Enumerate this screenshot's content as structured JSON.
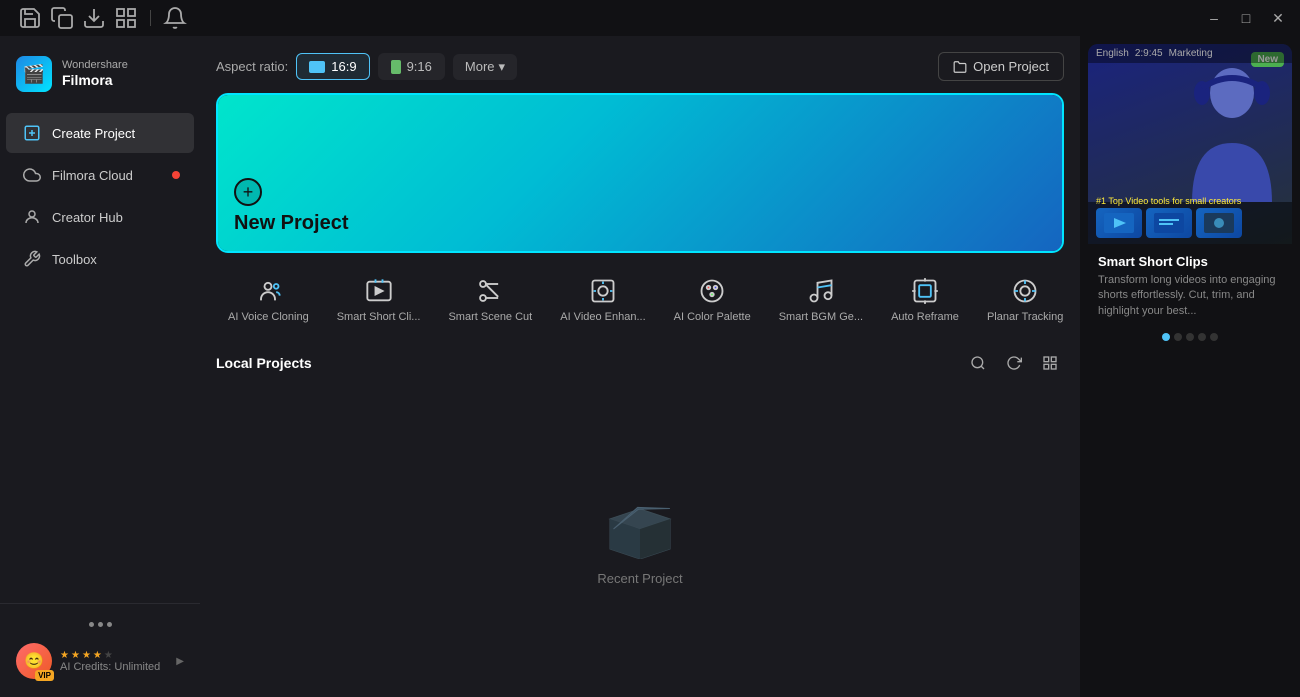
{
  "titlebar": {
    "icons": [
      "save-icon",
      "copy-icon",
      "download-icon",
      "grid-icon",
      "bell-icon"
    ],
    "window_controls": [
      "minimize-icon",
      "maximize-icon",
      "close-icon"
    ]
  },
  "sidebar": {
    "brand": "Wondershare",
    "product": "Filmora",
    "nav_items": [
      {
        "id": "create-project",
        "label": "Create Project",
        "active": true
      },
      {
        "id": "filmora-cloud",
        "label": "Filmora Cloud",
        "badge": true
      },
      {
        "id": "creator-hub",
        "label": "Creator Hub"
      },
      {
        "id": "toolbox",
        "label": "Toolbox"
      }
    ],
    "user": {
      "credits": "AI Credits: Unlimited",
      "vip": "VIP"
    }
  },
  "aspect_ratio": {
    "label": "Aspect ratio:",
    "options": [
      {
        "id": "16-9",
        "label": "16:9",
        "active": true
      },
      {
        "id": "9-16",
        "label": "9:16",
        "active": false
      }
    ],
    "more": "More"
  },
  "open_project": {
    "label": "Open Project"
  },
  "new_project": {
    "label": "New Project"
  },
  "tools": [
    {
      "id": "ai-voice-cloning",
      "label": "AI Voice Cloning"
    },
    {
      "id": "smart-short-clips",
      "label": "Smart Short Cli..."
    },
    {
      "id": "smart-scene-cut",
      "label": "Smart Scene Cut"
    },
    {
      "id": "ai-video-enhance",
      "label": "AI Video Enhan..."
    },
    {
      "id": "ai-color-palette",
      "label": "AI Color Palette"
    },
    {
      "id": "smart-bgm-gen",
      "label": "Smart BGM Ge..."
    },
    {
      "id": "auto-reframe",
      "label": "Auto Reframe"
    },
    {
      "id": "planar-tracking",
      "label": "Planar Tracking"
    }
  ],
  "local_projects": {
    "title": "Local Projects",
    "empty_label": "Recent Project"
  },
  "promo": {
    "badge": "New",
    "title": "Smart Short Clips",
    "description": "Transform long videos into engaging shorts effortlessly. Cut, trim, and highlight your best...",
    "rank": "#1 Top Video tools for small creators",
    "bar_items": [
      "English",
      "2:9:45",
      "Marketing"
    ],
    "dots_count": 5,
    "active_dot": 0
  }
}
